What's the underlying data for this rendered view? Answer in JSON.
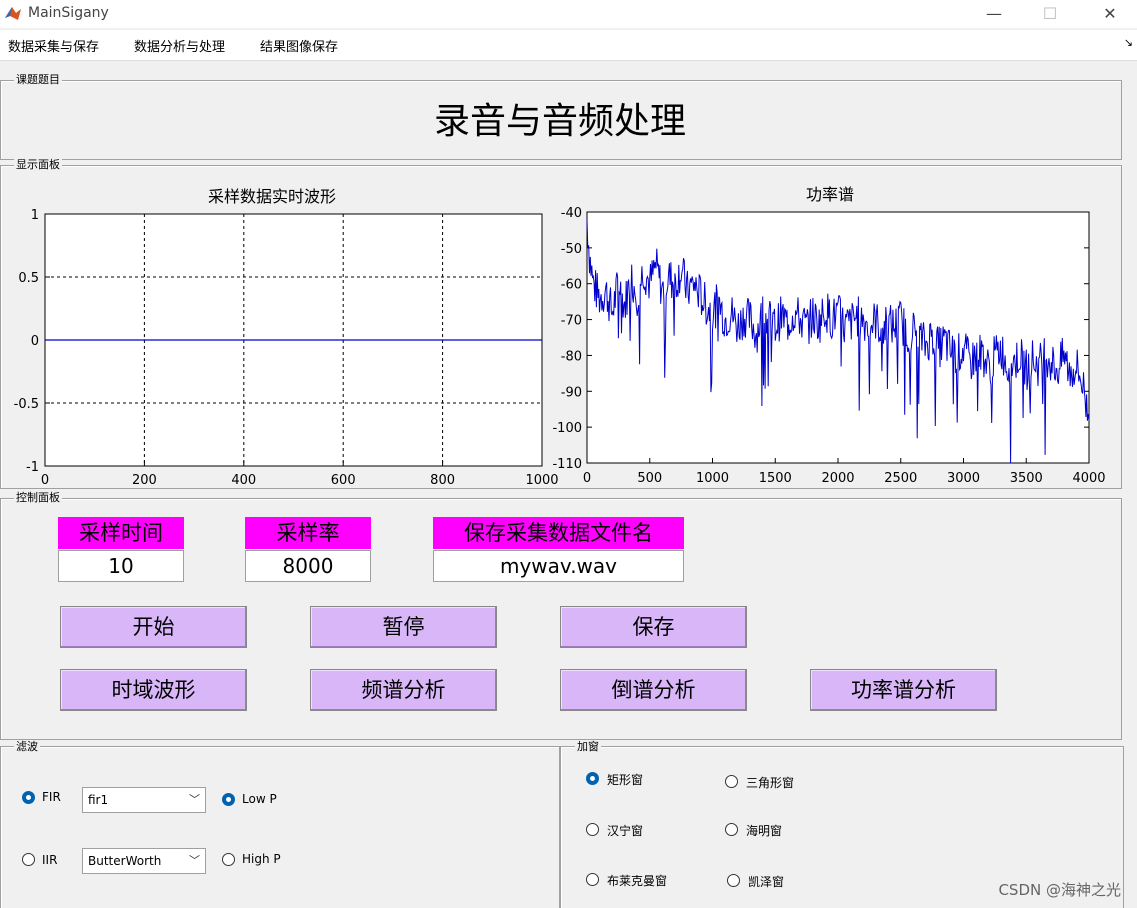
{
  "window": {
    "title": "MainSigany",
    "minimize": "—",
    "maximize": "☐",
    "close": "✕"
  },
  "menu": [
    "数据采集与保存",
    "数据分析与处理",
    "结果图像保存"
  ],
  "panels": {
    "topic": "课题题目",
    "display": "显示面板",
    "control": "控制面板",
    "filter": "滤波",
    "window_fn": "加窗"
  },
  "main_title": "录音与音频处理",
  "waveform": {
    "title": "采样数据实时波形",
    "x_ticks": [
      "0",
      "200",
      "400",
      "600",
      "800",
      "1000"
    ],
    "y_ticks": [
      "1",
      "0.5",
      "0",
      "-0.5",
      "-1"
    ]
  },
  "power": {
    "title": "功率谱",
    "x_ticks": [
      "0",
      "500",
      "1000",
      "1500",
      "2000",
      "2500",
      "3000",
      "3500",
      "4000"
    ],
    "y_ticks": [
      "-40",
      "-50",
      "-60",
      "-70",
      "-80",
      "-90",
      "-100",
      "-110"
    ]
  },
  "chart_data": [
    {
      "type": "line",
      "title": "采样数据实时波形",
      "xlim": [
        0,
        1000
      ],
      "ylim": [
        -1,
        1
      ],
      "grid": true,
      "x": [
        0,
        1000
      ],
      "values": [
        0,
        0
      ],
      "color": "#0000cc"
    },
    {
      "type": "line",
      "title": "功率谱",
      "xlim": [
        0,
        4000
      ],
      "ylim": [
        -110,
        -40
      ],
      "grid": false,
      "x": [
        0,
        20,
        50,
        100,
        150,
        200,
        250,
        300,
        350,
        400,
        450,
        500,
        550,
        600,
        650,
        700,
        750,
        800,
        850,
        900,
        950,
        1000,
        1050,
        1100,
        1150,
        1200,
        1250,
        1300,
        1350,
        1400,
        1450,
        1500,
        1550,
        1600,
        1650,
        1700,
        1750,
        1800,
        1850,
        1900,
        1950,
        2000,
        2050,
        2100,
        2150,
        2200,
        2250,
        2300,
        2350,
        2400,
        2450,
        2500,
        2550,
        2600,
        2650,
        2700,
        2750,
        2800,
        2850,
        2900,
        2950,
        3000,
        3050,
        3100,
        3150,
        3200,
        3250,
        3300,
        3350,
        3400,
        3450,
        3500,
        3550,
        3600,
        3650,
        3700,
        3750,
        3800,
        3850,
        3900,
        3950,
        4000
      ],
      "values": [
        -42,
        -52,
        -60,
        -64,
        -62,
        -68,
        -60,
        -66,
        -58,
        -63,
        -56,
        -60,
        -55,
        -62,
        -58,
        -60,
        -56,
        -62,
        -60,
        -63,
        -66,
        -68,
        -65,
        -70,
        -68,
        -72,
        -69,
        -70,
        -74,
        -68,
        -70,
        -72,
        -69,
        -71,
        -68,
        -70,
        -72,
        -69,
        -71,
        -67,
        -70,
        -68,
        -72,
        -71,
        -69,
        -70,
        -72,
        -70,
        -73,
        -71,
        -72,
        -70,
        -74,
        -73,
        -75,
        -77,
        -74,
        -78,
        -76,
        -79,
        -80,
        -78,
        -82,
        -80,
        -79,
        -84,
        -80,
        -78,
        -83,
        -82,
        -80,
        -84,
        -81,
        -83,
        -79,
        -82,
        -84,
        -80,
        -85,
        -83,
        -88,
        -98
      ],
      "color": "#0000cc"
    }
  ],
  "params": [
    {
      "label": "采样时间",
      "value": "10"
    },
    {
      "label": "采样率",
      "value": "8000"
    },
    {
      "label": "保存采集数据文件名",
      "value": "mywav.wav"
    }
  ],
  "buttons": {
    "start": "开始",
    "pause": "暂停",
    "save": "保存",
    "time_wave": "时域波形",
    "spectrum": "频谱分析",
    "cepstrum": "倒谱分析",
    "power_spectrum": "功率谱分析"
  },
  "filter": {
    "fir": "FIR",
    "iir": "IIR",
    "fir_select": "fir1",
    "iir_select": "ButterWorth",
    "low": "Low P",
    "high": "High P"
  },
  "window_options": {
    "rect": "矩形窗",
    "triangle": "三角形窗",
    "hanning": "汉宁窗",
    "hamming": "海明窗",
    "blackman": "布莱克曼窗",
    "kaiser": "凯泽窗"
  },
  "watermark": "CSDN @海神之光"
}
